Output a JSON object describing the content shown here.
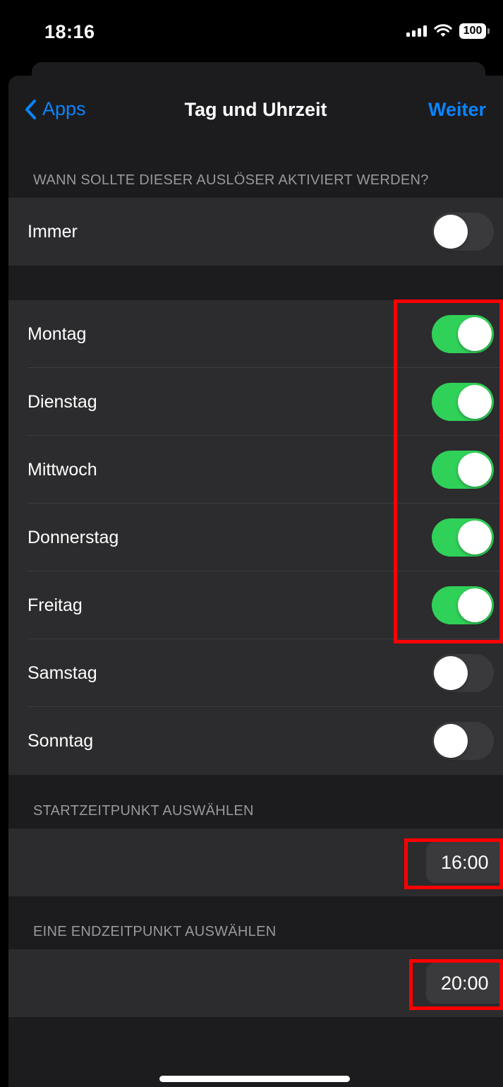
{
  "status_bar": {
    "time": "18:16",
    "battery": "100"
  },
  "nav": {
    "back_label": "Apps",
    "title": "Tag und Uhrzeit",
    "next_label": "Weiter"
  },
  "section_when": {
    "header": "WANN SOLLTE DIESER AUSLÖSER AKTIVIERT WERDEN?",
    "always": {
      "label": "Immer",
      "on": false
    }
  },
  "days": [
    {
      "label": "Montag",
      "on": true
    },
    {
      "label": "Dienstag",
      "on": true
    },
    {
      "label": "Mittwoch",
      "on": true
    },
    {
      "label": "Donnerstag",
      "on": true
    },
    {
      "label": "Freitag",
      "on": true
    },
    {
      "label": "Samstag",
      "on": false
    },
    {
      "label": "Sonntag",
      "on": false
    }
  ],
  "start": {
    "header": "STARTZEITPUNKT AUSWÄHLEN",
    "time": "16:00"
  },
  "end": {
    "header": "EINE ENDZEITPUNKT AUSWÄHLEN",
    "time": "20:00"
  },
  "colors": {
    "accent": "#0a84ff",
    "toggle_on": "#30d158",
    "highlight": "#ff0000"
  }
}
